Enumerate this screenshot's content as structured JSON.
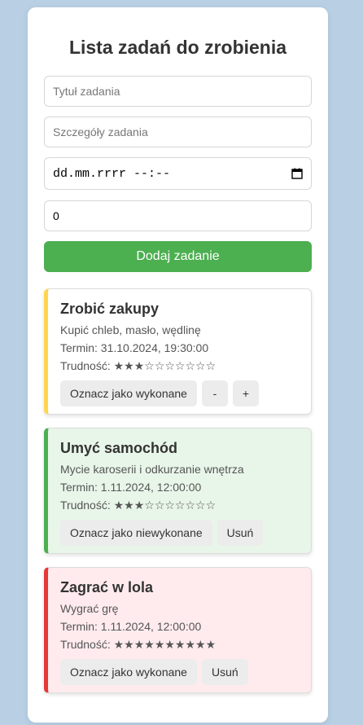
{
  "app": {
    "title": "Lista zadań do zrobienia"
  },
  "form": {
    "title_placeholder": "Tytuł zadania",
    "details_placeholder": "Szczegóły zadania",
    "date_value": "dd.mm.rrrr --:--",
    "difficulty_value": "0",
    "add_label": "Dodaj zadanie"
  },
  "colors": {
    "accent_green": "#4caf50",
    "pending_border": "#ffd54f",
    "done_border": "#4caf50",
    "done_bg": "#e8f5e9",
    "hard_border": "#e53935",
    "hard_bg": "#ffebee"
  },
  "tasks": [
    {
      "title": "Zrobić zakupy",
      "details": "Kupić chleb, masło, wędlinę",
      "deadline": "Termin: 31.10.2024, 19:30:00",
      "difficulty_label": "Trudność:",
      "stars": "★★★☆☆☆☆☆☆☆",
      "difficulty": 3,
      "toggle_label": "Oznacz jako wykonane",
      "minus_label": "-",
      "plus_label": "+"
    },
    {
      "title": "Umyć samochód",
      "details": "Mycie karoserii i odkurzanie wnętrza",
      "deadline": "Termin: 1.11.2024, 12:00:00",
      "difficulty_label": "Trudność:",
      "stars": "★★★☆☆☆☆☆☆☆",
      "difficulty": 3,
      "toggle_label": "Oznacz jako niewykonane",
      "delete_label": "Usuń"
    },
    {
      "title": "Zagrać w lola",
      "details": "Wygrać grę",
      "deadline": "Termin: 1.11.2024, 12:00:00",
      "difficulty_label": "Trudność:",
      "stars": "★★★★★★★★★★",
      "difficulty": 10,
      "toggle_label": "Oznacz jako wykonane",
      "delete_label": "Usuń"
    }
  ]
}
